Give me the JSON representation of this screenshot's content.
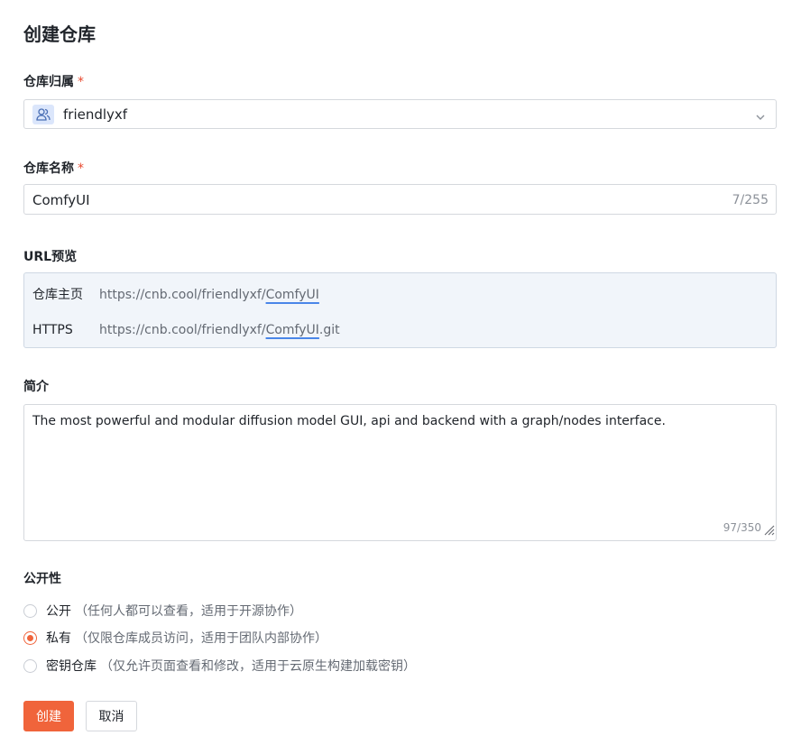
{
  "page_title": "创建仓库",
  "owner": {
    "label": "仓库归属",
    "required_mark": "*",
    "value": "friendlyxf",
    "icon": "user-group-icon"
  },
  "repo_name": {
    "label": "仓库名称",
    "required_mark": "*",
    "value": "ComfyUI",
    "counter": "7/255"
  },
  "url_preview": {
    "label": "URL预览",
    "rows": [
      {
        "key": "仓库主页",
        "prefix": "https://cnb.cool/friendlyxf/",
        "name": "ComfyUI",
        "suffix": ""
      },
      {
        "key": "HTTPS",
        "prefix": "https://cnb.cool/friendlyxf/",
        "name": "ComfyUI",
        "suffix": ".git"
      }
    ]
  },
  "description": {
    "label": "简介",
    "value": "The most powerful and modular diffusion model GUI, api and backend with a graph/nodes interface.",
    "counter": "97/350"
  },
  "visibility": {
    "label": "公开性",
    "options": [
      {
        "label": "公开",
        "desc": "（任何人都可以查看，适用于开源协作）",
        "checked": false
      },
      {
        "label": "私有",
        "desc": "（仅限仓库成员访问，适用于团队内部协作）",
        "checked": true
      },
      {
        "label": "密钥仓库",
        "desc": "（仅允许页面查看和修改，适用于云原生构建加载密钥）",
        "checked": false
      }
    ]
  },
  "buttons": {
    "create": "创建",
    "cancel": "取消"
  },
  "colors": {
    "accent": "#f0643b",
    "required": "#e84a30",
    "link_underline": "#4a86e8"
  }
}
